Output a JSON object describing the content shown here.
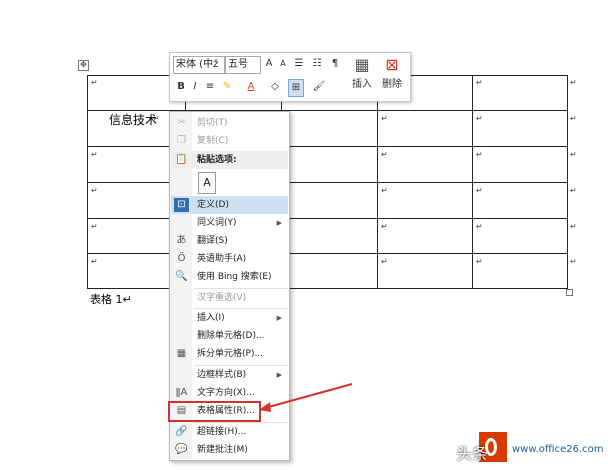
{
  "toolbar": {
    "font_name": "宋体 (中ž",
    "font_size": "五号",
    "bold": "B",
    "italic": "I",
    "align": "≡",
    "font_color_letter": "A",
    "insert_label": "插入",
    "delete_label": "删除",
    "font_grow": "A",
    "font_shrink": "A",
    "accent_color": "#d9342b"
  },
  "table": {
    "rows": 6,
    "columns": 5,
    "cell_text": "信息技术",
    "cell_mark": "↵",
    "move_handle": "✥",
    "caption": "表格 1↵"
  },
  "context_menu": {
    "items": [
      {
        "label": "剪切(T)",
        "icon": "scissors-icon",
        "glyph": "✂",
        "disabled": true
      },
      {
        "label": "复制(C)",
        "icon": "copy-icon",
        "glyph": "❐",
        "disabled": true
      },
      {
        "label": "粘贴选项:",
        "icon": "paste-icon",
        "glyph": "📋",
        "header": true
      },
      {
        "label": "定义(D)",
        "icon": "define-icon",
        "glyph": "⊡",
        "selected": true
      },
      {
        "label": "同义词(Y)",
        "icon": "",
        "glyph": "",
        "submenu": true
      },
      {
        "label": "翻译(S)",
        "icon": "translate-icon",
        "glyph": "あ"
      },
      {
        "label": "英语助手(A)",
        "icon": "english-assistant-icon",
        "glyph": "Ӧ"
      },
      {
        "label": "使用 Bing 搜索(E)",
        "icon": "bing-search-icon",
        "glyph": "🔍"
      },
      {
        "label": "汉字重选(V)",
        "icon": "",
        "glyph": "",
        "disabled": true
      },
      {
        "label": "插入(I)",
        "icon": "",
        "glyph": "",
        "submenu": true
      },
      {
        "label": "删除单元格(D)...",
        "icon": "",
        "glyph": ""
      },
      {
        "label": "拆分单元格(P)...",
        "icon": "split-cells-icon",
        "glyph": "▦"
      },
      {
        "label": "边框样式(B)",
        "icon": "",
        "glyph": "",
        "submenu": true
      },
      {
        "label": "文字方向(X)...",
        "icon": "text-direction-icon",
        "glyph": "ǁA"
      },
      {
        "label": "表格属性(R)...",
        "icon": "table-properties-icon",
        "glyph": "▤"
      },
      {
        "label": "超链接(H)...",
        "icon": "hyperlink-icon",
        "glyph": "🔗"
      },
      {
        "label": "新建批注(M)",
        "icon": "new-comment-icon",
        "glyph": "💬"
      }
    ],
    "paste_option_glyph": "A",
    "submenu_arrow": "▶"
  },
  "watermark": {
    "text": "头条",
    "site": "www.office26.com"
  },
  "colors": {
    "annotation_red": "#d0342c",
    "menu_selected": "#cfe0f3",
    "office_orange": "#d83b01"
  }
}
